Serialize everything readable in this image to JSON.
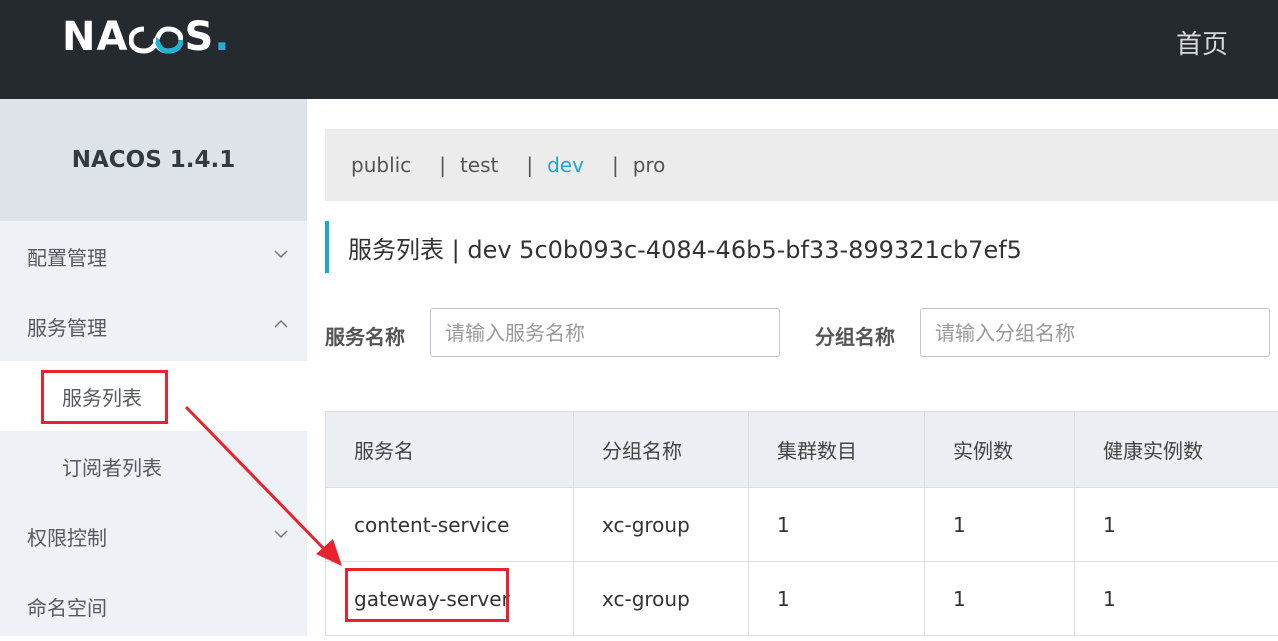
{
  "header": {
    "logo": {
      "text_a": "NA",
      "text_b": "S",
      "dot": ".",
      "accent": "#1fb2d8"
    },
    "home_label": "首页"
  },
  "sidebar": {
    "version": "NACOS 1.4.1",
    "items": [
      {
        "label": "配置管理",
        "icon": "chevron-down-icon"
      },
      {
        "label": "服务管理",
        "icon": "chevron-up-icon"
      },
      {
        "label": "服务列表",
        "sub": true,
        "active": true
      },
      {
        "label": "订阅者列表",
        "sub": true
      },
      {
        "label": "权限控制",
        "icon": "chevron-down-icon"
      },
      {
        "label": "命名空间"
      }
    ]
  },
  "namespaces": {
    "items": [
      "public",
      "test",
      "dev",
      "pro"
    ],
    "separator": "|",
    "active": "dev"
  },
  "page": {
    "title": "服务列表 | dev 5c0b093c-4084-46b5-bf33-899321cb7ef5"
  },
  "search": {
    "service_label": "服务名称",
    "service_placeholder": "请输入服务名称",
    "group_label": "分组名称",
    "group_placeholder": "请输入分组名称"
  },
  "table": {
    "columns": [
      "服务名",
      "分组名称",
      "集群数目",
      "实例数",
      "健康实例数"
    ],
    "rows": [
      [
        "content-service",
        "xc-group",
        "1",
        "1",
        "1"
      ],
      [
        "gateway-server",
        "xc-group",
        "1",
        "1",
        "1"
      ]
    ]
  },
  "annotation": {
    "color": "#e8232d"
  }
}
